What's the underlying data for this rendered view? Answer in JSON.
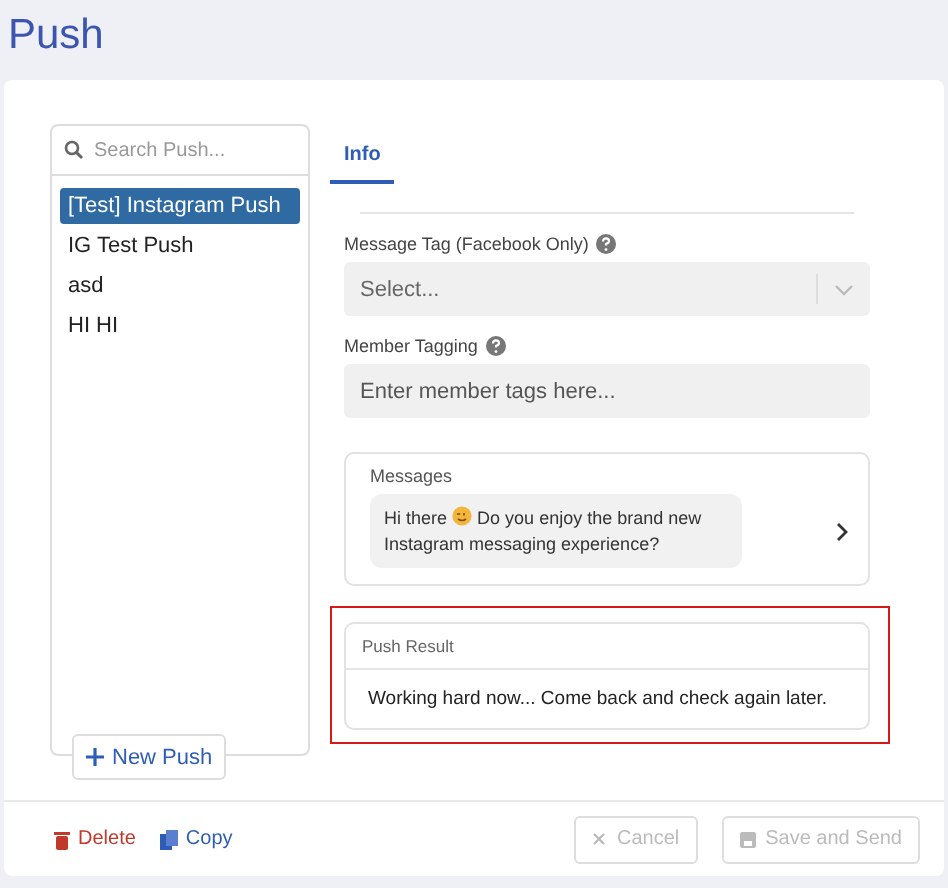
{
  "page_title": "Push",
  "search": {
    "placeholder": "Search Push..."
  },
  "push_list": [
    {
      "label": "[Test] Instagram Push",
      "selected": true
    },
    {
      "label": "IG Test Push",
      "selected": false
    },
    {
      "label": "asd",
      "selected": false
    },
    {
      "label": "HI HI",
      "selected": false
    }
  ],
  "new_push_button": "New Push",
  "tabs": [
    {
      "label": "Info",
      "selected": true
    }
  ],
  "message_tag": {
    "label": "Message Tag (Facebook Only)",
    "placeholder": "Select..."
  },
  "member_tagging": {
    "label": "Member Tagging",
    "placeholder": "Enter member tags here..."
  },
  "messages": {
    "title": "Messages",
    "text_before_emoji": "Hi there",
    "text_after_emoji": "Do you enjoy the brand new Instagram messaging experience?"
  },
  "push_result": {
    "title": "Push Result",
    "text": "Working hard now... Come back and check again later.",
    "highlighted": true
  },
  "footer": {
    "delete": "Delete",
    "copy": "Copy",
    "cancel": {
      "label": "Cancel",
      "disabled": true
    },
    "save": {
      "label": "Save and Send",
      "disabled": true
    }
  }
}
